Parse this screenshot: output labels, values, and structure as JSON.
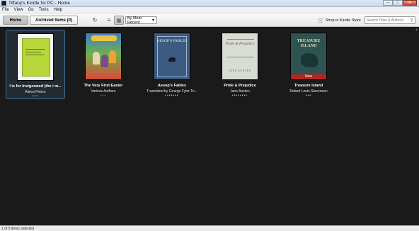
{
  "window": {
    "title": "Tiffany's Kindle for PC - Home",
    "minimize_glyph": "–",
    "maximize_glyph": "□",
    "close_glyph": "✕"
  },
  "menu": {
    "items": [
      "File",
      "View",
      "Go",
      "Tools",
      "Help"
    ]
  },
  "toolbar": {
    "home_tab": "Home",
    "archived_tab": "Archived Items (0)",
    "sort_value": "By Most Recent",
    "shop_label": "Shop in Kindle Store",
    "search_placeholder": "Search Titles & Authors"
  },
  "library": {
    "books": [
      {
        "title": "I is for Invigorated (the i m...",
        "author": "Adrea Peters",
        "dots": "•••",
        "cover_title": "Invigorated",
        "selected": true
      },
      {
        "title": "The Very First Easter",
        "author": "Various Authors",
        "dots": "•••",
        "cover_title": "The Very First Easter"
      },
      {
        "title": "Aesop's Fables",
        "author": "Translated by George Fyler To...",
        "dots": "•••••••",
        "cover_title": "AESOP'S FABLES"
      },
      {
        "title": "Pride & Prejudice",
        "author": "Jane Austen",
        "dots": "••••••••",
        "cover_title": "Pride & Prejudice",
        "cover_author": "JANE AUSTEN"
      },
      {
        "title": "Treasure Island",
        "author": "Robert Louis Stevenson",
        "dots": "•••",
        "cover_title": "TREASURE ISLAND",
        "badge": "New"
      }
    ]
  },
  "status": {
    "text": "1 of 5 items selected"
  },
  "colors": {
    "library_bg": "#1a1a1a",
    "selection_border": "#3d6f98",
    "new_badge": "#b3261e"
  }
}
